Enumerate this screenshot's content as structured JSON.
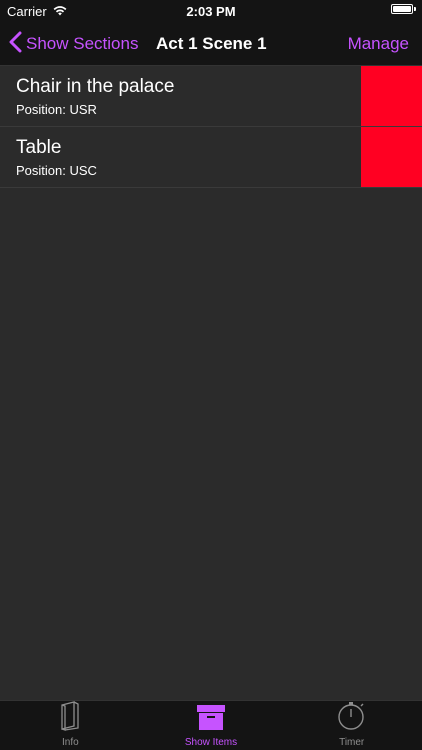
{
  "status_bar": {
    "carrier": "Carrier",
    "time": "2:03 PM"
  },
  "nav": {
    "back_label": "Show Sections",
    "title": "Act 1 Scene 1",
    "manage_label": "Manage"
  },
  "items": [
    {
      "title": "Chair in the palace",
      "position": "Position: USR",
      "color": "#ff0022"
    },
    {
      "title": "Table",
      "position": "Position: USC",
      "color": "#ff0022"
    }
  ],
  "tabs": [
    {
      "label": "Info",
      "icon": "book-icon"
    },
    {
      "label": "Show Items",
      "icon": "box-icon",
      "active": true
    },
    {
      "label": "Timer",
      "icon": "stopwatch-icon"
    }
  ],
  "colors": {
    "accent": "#c653ff",
    "background": "#2b2b2b",
    "bar": "#141414",
    "swatch": "#ff0022"
  }
}
